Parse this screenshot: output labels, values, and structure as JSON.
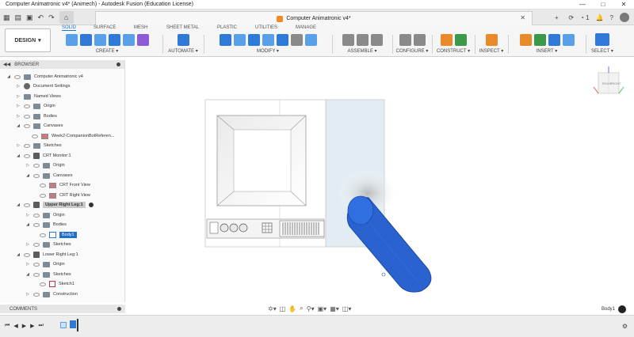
{
  "window": {
    "title": "Computer Animatronic v4* (Animech) - Autodesk Fusion (Education License)",
    "min_glyph": "—",
    "max_glyph": "□",
    "close_glyph": "✕"
  },
  "document_tab": {
    "title": "Computer Animatronic v4*",
    "close_glyph": "✕"
  },
  "quick_access": {
    "right_count": "1"
  },
  "toolbar": {
    "workspace_label": "DESIGN",
    "tabs": [
      "SOLID",
      "SURFACE",
      "MESH",
      "SHEET METAL",
      "PLASTIC",
      "UTILITIES",
      "MANAGE"
    ],
    "groups": [
      "CREATE",
      "AUTOMATE",
      "MODIFY",
      "ASSEMBLE",
      "CONFIGURE",
      "CONSTRUCT",
      "INSPECT",
      "INSERT",
      "SELECT"
    ]
  },
  "browser": {
    "header": "BROWSER",
    "items": [
      "Computer Animatronic v4",
      "Document Settings",
      "Named Views",
      "Origin",
      "Bodies",
      "Canvases",
      "Week2-CompanionBotReferen...",
      "Sketches",
      "CRT Monitor:1",
      "Origin",
      "Canvases",
      "CRT Front View",
      "CRT Right View",
      "Upper Right Leg:1",
      "Origin",
      "Bodies",
      "Body1",
      "Sketches",
      "Lower Right Leg:1",
      "Origin",
      "Sketches",
      "Sketch1",
      "Construction"
    ]
  },
  "comments": {
    "header": "COMMENTS"
  },
  "viewcube": {
    "face_right": "RIGHT",
    "face_front": "FRONT"
  },
  "status": {
    "selection": "Body1"
  },
  "colors": {
    "accent": "#1a73c9",
    "body_blue": "#2a63cf"
  }
}
